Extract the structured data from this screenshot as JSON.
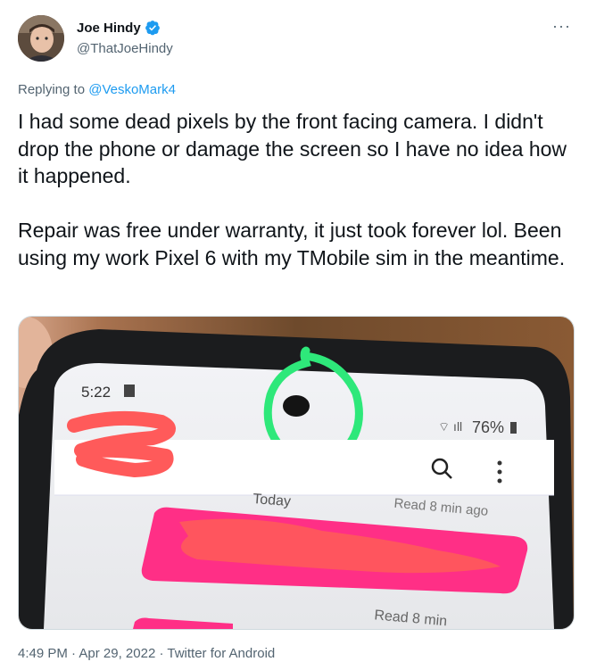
{
  "author": {
    "name": "Joe Hindy",
    "handle": "@ThatJoeHindy"
  },
  "reply": {
    "prefix": "Replying to ",
    "target": "@VeskoMark4"
  },
  "tweet": {
    "text": "I had some dead pixels by the front facing camera. I didn't drop the phone or damage the screen so I have no idea how it happened.\n\nRepair was free under warranty, it just took forever lol. Been using my work Pixel 6 with my TMobile sim in the meantime."
  },
  "photo": {
    "status_time": "5:22",
    "battery": "76%",
    "date_divider": "Today",
    "read_label_1": "Read 8 min ago",
    "read_label_2": "Read 8 min",
    "circle_color": "#2ee87a",
    "scribble_color": "#ff5a5a",
    "bubble_color": "#ff2f86"
  },
  "meta": {
    "time": "4:49 PM",
    "sep1": " · ",
    "date": "Apr 29, 2022",
    "sep2": " · ",
    "source": "Twitter for Android"
  },
  "colors": {
    "link": "#1d9bf0",
    "secondary": "#536471",
    "verified": "#1d9bf0"
  }
}
